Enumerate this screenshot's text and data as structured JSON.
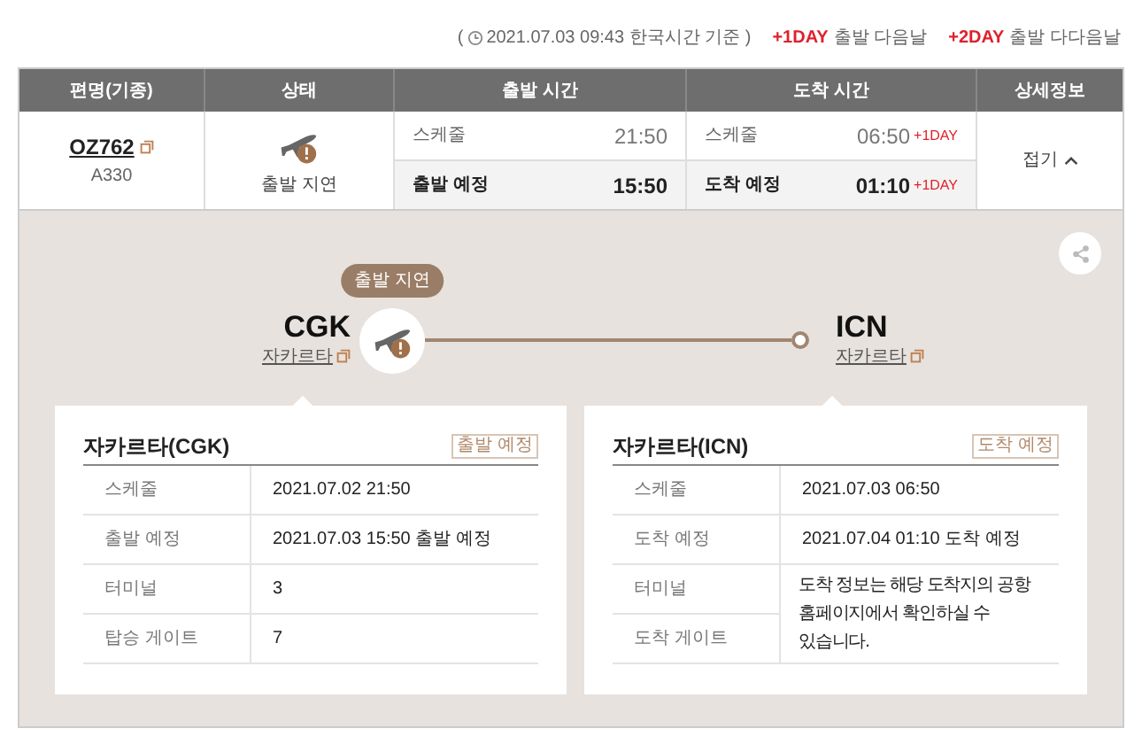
{
  "legend": {
    "open": "(",
    "text": "2021.07.03 09:43 한국시간 기준 )",
    "items": [
      {
        "tag": "+1DAY",
        "text": "출발 다음날"
      },
      {
        "tag": "+2DAY",
        "text": "출발 다다음날"
      }
    ]
  },
  "table": {
    "columns": [
      "편명(기종)",
      "상태",
      "출발 시간",
      "도착 시간",
      "상세정보"
    ],
    "flight": {
      "number": "OZ762",
      "aircraft": "A330"
    },
    "status": "출발 지연",
    "departure": [
      {
        "kind": "scheduled",
        "label": "스케줄",
        "time": "21:50"
      },
      {
        "kind": "expected",
        "label": "출발 예정",
        "time": "15:50"
      }
    ],
    "arrival": [
      {
        "kind": "scheduled",
        "label": "스케줄",
        "time": "06:50",
        "day": "+1DAY"
      },
      {
        "kind": "expected",
        "label": "도착 예정",
        "time": "01:10",
        "day": "+1DAY"
      }
    ],
    "detail_toggle": {
      "label": "접기",
      "expanded": true
    }
  },
  "route": {
    "badge": "출발 지연",
    "origin": {
      "code": "CGK",
      "city": "자카르타"
    },
    "destination": {
      "code": "ICN",
      "city": "자카르타"
    }
  },
  "cards": [
    {
      "title": "자카르타(CGK)",
      "tag": "출발 예정",
      "rows": [
        {
          "label": "스케줄",
          "value": "2021.07.02 21:50"
        },
        {
          "label": "출발 예정",
          "value": "2021.07.03 15:50 출발 예정"
        },
        {
          "label": "터미널",
          "value": "3"
        },
        {
          "label": "탑승 게이트",
          "value": "7"
        }
      ]
    },
    {
      "title": "자카르타(ICN)",
      "tag": "도착 예정",
      "rows": [
        {
          "label": "스케줄",
          "value": "2021.07.03 06:50"
        },
        {
          "label": "도착 예정",
          "value": "2021.07.04 01:10 도착 예정"
        },
        {
          "label": "터미널"
        },
        {
          "label": "도착 게이트"
        }
      ],
      "note": "도착 정보는 해당 도착지의 공항 홈페이지에서 확인하실 수 있습니다."
    }
  ]
}
